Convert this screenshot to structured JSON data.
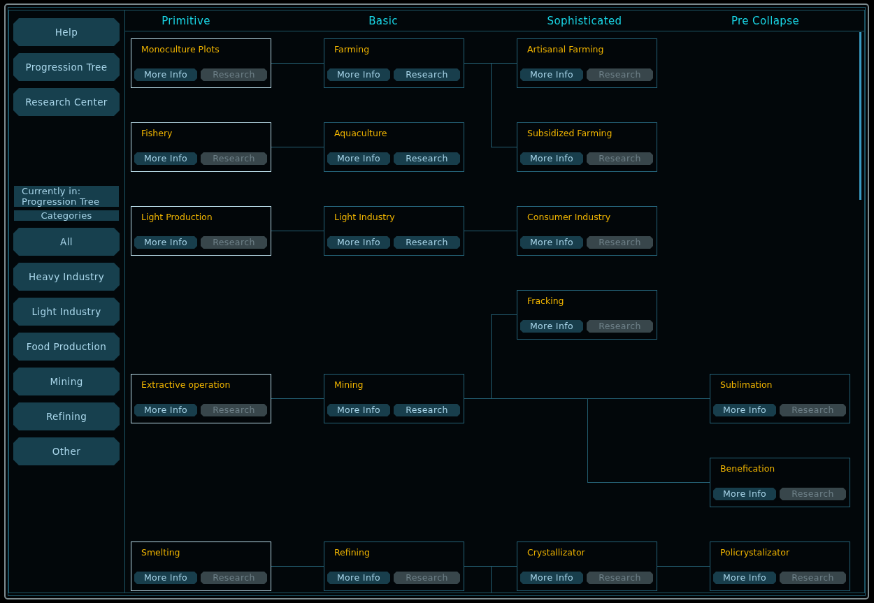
{
  "sidebar": {
    "nav_buttons": [
      "Help",
      "Progression Tree",
      "Research Center"
    ],
    "location_label": "Currently in: Progression Tree",
    "categories_label": "Categories",
    "category_buttons": [
      "All",
      "Heavy Industry",
      "Light Industry",
      "Food Production",
      "Mining",
      "Refining",
      "Other"
    ]
  },
  "tree": {
    "columns": [
      "Primitive",
      "Basic",
      "Sophisticated",
      "Pre Collapse"
    ],
    "rows": [
      [
        {
          "name": "Monoculture Plots",
          "researched": true,
          "links": [
            {
              "kind": "straight"
            }
          ],
          "buttons": [
            {
              "label": "More Info",
              "disabled": false
            },
            {
              "label": "Research",
              "disabled": true
            }
          ]
        },
        {
          "name": "Farming",
          "researched": false,
          "links": [
            {
              "kind": "straight"
            },
            {
              "kind": "elbow_down"
            }
          ],
          "buttons": [
            {
              "label": "More Info",
              "disabled": false
            },
            {
              "label": "Research",
              "disabled": false
            }
          ]
        },
        {
          "name": "Artisanal Farming",
          "researched": false,
          "buttons": [
            {
              "label": "More Info",
              "disabled": false
            },
            {
              "label": "Research",
              "disabled": true
            }
          ]
        },
        null
      ],
      [
        {
          "name": "Fishery",
          "researched": true,
          "links": [
            {
              "kind": "straight"
            }
          ],
          "buttons": [
            {
              "label": "More Info",
              "disabled": false
            },
            {
              "label": "Research",
              "disabled": true
            }
          ]
        },
        {
          "name": "Aquaculture",
          "researched": false,
          "buttons": [
            {
              "label": "More Info",
              "disabled": false
            },
            {
              "label": "Research",
              "disabled": false
            }
          ]
        },
        {
          "name": "Subsidized Farming",
          "researched": false,
          "buttons": [
            {
              "label": "More Info",
              "disabled": false
            },
            {
              "label": "Research",
              "disabled": true
            }
          ]
        },
        null
      ],
      [
        {
          "name": "Light Production",
          "researched": true,
          "links": [
            {
              "kind": "straight"
            }
          ],
          "buttons": [
            {
              "label": "More Info",
              "disabled": false
            },
            {
              "label": "Research",
              "disabled": true
            }
          ]
        },
        {
          "name": "Light Industry",
          "researched": false,
          "links": [
            {
              "kind": "straight"
            }
          ],
          "buttons": [
            {
              "label": "More Info",
              "disabled": false
            },
            {
              "label": "Research",
              "disabled": false
            }
          ]
        },
        {
          "name": "Consumer Industry",
          "researched": false,
          "buttons": [
            {
              "label": "More Info",
              "disabled": false
            },
            {
              "label": "Research",
              "disabled": true
            }
          ]
        },
        null
      ],
      [
        null,
        null,
        {
          "name": "Fracking",
          "researched": false,
          "buttons": [
            {
              "label": "More Info",
              "disabled": false
            },
            {
              "label": "Research",
              "disabled": true
            }
          ]
        },
        null
      ],
      [
        {
          "name": "Extractive operation",
          "researched": true,
          "links": [
            {
              "kind": "straight"
            }
          ],
          "buttons": [
            {
              "label": "More Info",
              "disabled": false
            },
            {
              "label": "Research",
              "disabled": true
            }
          ]
        },
        {
          "name": "Mining",
          "researched": false,
          "links": [
            {
              "kind": "elbow_up"
            },
            {
              "kind": "long_straight"
            },
            {
              "kind": "long_elbow_down"
            }
          ],
          "buttons": [
            {
              "label": "More Info",
              "disabled": false
            },
            {
              "label": "Research",
              "disabled": false
            }
          ]
        },
        null,
        {
          "name": "Sublimation",
          "researched": false,
          "buttons": [
            {
              "label": "More Info",
              "disabled": false
            },
            {
              "label": "Research",
              "disabled": true
            }
          ]
        }
      ],
      [
        null,
        null,
        null,
        {
          "name": "Benefication",
          "researched": false,
          "buttons": [
            {
              "label": "More Info",
              "disabled": false
            },
            {
              "label": "Research",
              "disabled": true
            }
          ]
        }
      ],
      [
        {
          "name": "Smelting",
          "researched": true,
          "links": [
            {
              "kind": "straight"
            }
          ],
          "buttons": [
            {
              "label": "More Info",
              "disabled": false
            },
            {
              "label": "Research",
              "disabled": true
            }
          ]
        },
        {
          "name": "Refining",
          "researched": false,
          "links": [
            {
              "kind": "straight"
            },
            {
              "kind": "elbow_down"
            }
          ],
          "buttons": [
            {
              "label": "More Info",
              "disabled": false
            },
            {
              "label": "Research",
              "disabled": true
            }
          ]
        },
        {
          "name": "Crystallizator",
          "researched": false,
          "links": [
            {
              "kind": "straight"
            }
          ],
          "buttons": [
            {
              "label": "More Info",
              "disabled": false
            },
            {
              "label": "Research",
              "disabled": true
            }
          ]
        },
        {
          "name": "Policrystalizator",
          "researched": false,
          "buttons": [
            {
              "label": "More Info",
              "disabled": false
            },
            {
              "label": "Research",
              "disabled": true
            }
          ]
        }
      ]
    ]
  }
}
